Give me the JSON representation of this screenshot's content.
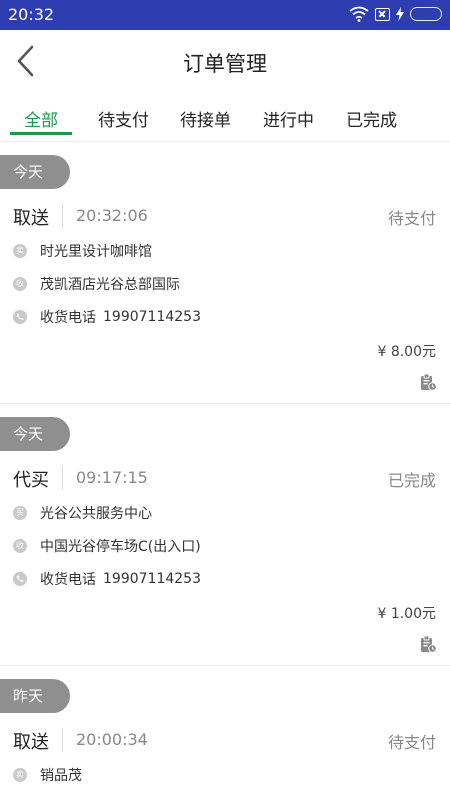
{
  "status_bar": {
    "time": "20:32"
  },
  "header": {
    "title": "订单管理"
  },
  "tabs": [
    {
      "label": "全部",
      "active": true
    },
    {
      "label": "待支付"
    },
    {
      "label": "待接单"
    },
    {
      "label": "进行中"
    },
    {
      "label": "已完成"
    }
  ],
  "orders": [
    {
      "day": "今天",
      "type": "取送",
      "time": "20:32:06",
      "status": "待支付",
      "from_icon": "卖",
      "from": "时光里设计咖啡馆",
      "to_icon": "收",
      "to": "茂凯酒店光谷总部国际",
      "phone_label": "收货电话",
      "phone": "19907114253",
      "price": "¥ 8.00元"
    },
    {
      "day": "今天",
      "type": "代买",
      "time": "09:17:15",
      "status": "已完成",
      "from_icon": "买",
      "from": "光谷公共服务中心",
      "to_icon": "收",
      "to": "中国光谷停车场C(出入口)",
      "phone_label": "收货电话",
      "phone": "19907114253",
      "price": "¥ 1.00元"
    },
    {
      "day": "昨天",
      "type": "取送",
      "time": "20:00:34",
      "status": "待支付",
      "from_icon": "卖",
      "from": "销品茂"
    }
  ],
  "colors": {
    "status_bar": "#2e3db0",
    "accent": "#1a9a4a",
    "pill": "#8f8f8f"
  }
}
